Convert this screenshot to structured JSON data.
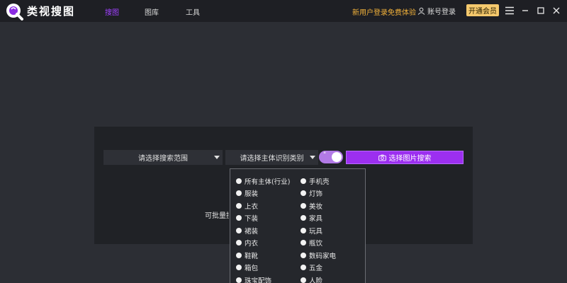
{
  "app": {
    "brand": "类视搜图"
  },
  "nav": {
    "tabs": [
      "搜图",
      "图库",
      "工具"
    ]
  },
  "header": {
    "promo": "新用户登录免费体验",
    "account_login": "账号登录",
    "vip": "开通会员"
  },
  "search": {
    "scope_placeholder": "请选择搜索范围",
    "type_placeholder": "请选择主体识别类别",
    "toggle_text": "\"",
    "upload_button": "选择图片搜索",
    "batch_text": "可批量搜"
  },
  "dropdown": {
    "left": [
      "所有主体(行业)",
      "服装",
      "上衣",
      "下装",
      "裙装",
      "内衣",
      "鞋靴",
      "箱包",
      "珠宝配饰"
    ],
    "right": [
      "手机壳",
      "灯饰",
      "美妆",
      "家具",
      "玩具",
      "瓶饮",
      "数码家电",
      "五金",
      "人脸"
    ]
  },
  "colors": {
    "accent": "#9c2ff0",
    "promo": "#f3b23a",
    "vip": "#f5c96d",
    "bg": "#2c2e34"
  }
}
